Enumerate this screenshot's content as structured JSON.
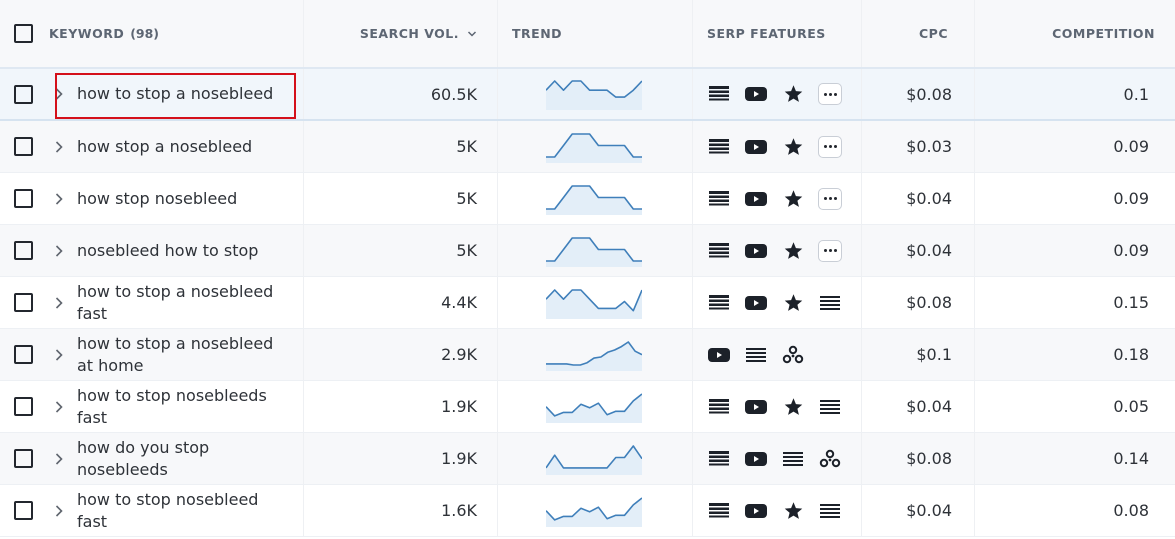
{
  "header": {
    "keyword_label": "KEYWORD",
    "keyword_count": "(98)",
    "search_vol_label": "SEARCH VOL.",
    "trend_label": "TREND",
    "serp_label": "SERP FEATURES",
    "cpc_label": "CPC",
    "competition_label": "COMPETITION"
  },
  "colors": {
    "trend_line": "#3f7fba",
    "trend_fill": "#e3eef8",
    "highlight_border": "#d4101a",
    "icon_color": "#1c2129"
  },
  "rows": [
    {
      "keyword": "how to stop a nosebleed",
      "volume": "60.5K",
      "cpc": "$0.08",
      "competition": "0.1",
      "highlighted": true,
      "trend": [
        0.6,
        1,
        0.6,
        1,
        1,
        0.6,
        0.6,
        0.6,
        0.3,
        0.3,
        0.6,
        1
      ],
      "serp": [
        "featured-snippet-icon",
        "video-icon",
        "review-star-icon",
        "more-icon"
      ]
    },
    {
      "keyword": "how stop a nosebleed",
      "volume": "5K",
      "cpc": "$0.03",
      "competition": "0.09",
      "highlighted": false,
      "trend": [
        0,
        0,
        0.5,
        1,
        1,
        1,
        0.5,
        0.5,
        0.5,
        0.5,
        0,
        0
      ],
      "serp": [
        "featured-snippet-icon",
        "video-icon",
        "review-star-icon",
        "more-icon"
      ]
    },
    {
      "keyword": "how stop nosebleed",
      "volume": "5K",
      "cpc": "$0.04",
      "competition": "0.09",
      "highlighted": false,
      "trend": [
        0,
        0,
        0.5,
        1,
        1,
        1,
        0.5,
        0.5,
        0.5,
        0.5,
        0,
        0
      ],
      "serp": [
        "featured-snippet-icon",
        "video-icon",
        "review-star-icon",
        "more-icon"
      ]
    },
    {
      "keyword": "nosebleed how to stop",
      "volume": "5K",
      "cpc": "$0.04",
      "competition": "0.09",
      "highlighted": false,
      "trend": [
        0,
        0,
        0.5,
        1,
        1,
        1,
        0.5,
        0.5,
        0.5,
        0.5,
        0,
        0
      ],
      "serp": [
        "featured-snippet-icon",
        "video-icon",
        "review-star-icon",
        "more-icon"
      ]
    },
    {
      "keyword": "how to stop a nosebleed fast",
      "volume": "4.4K",
      "cpc": "$0.08",
      "competition": "0.15",
      "highlighted": false,
      "trend": [
        0.6,
        1,
        0.6,
        1,
        1,
        0.6,
        0.2,
        0.2,
        0.2,
        0.5,
        0.1,
        1
      ],
      "serp": [
        "featured-snippet-icon",
        "video-icon",
        "review-star-icon",
        "list-icon"
      ]
    },
    {
      "keyword": "how to stop a nosebleed at home",
      "volume": "2.9K",
      "cpc": "$0.1",
      "competition": "0.18",
      "highlighted": false,
      "trend": [
        0.05,
        0.05,
        0.05,
        0.05,
        0,
        0,
        0.1,
        0.3,
        0.35,
        0.55,
        0.65,
        0.8,
        1,
        0.6,
        0.45
      ],
      "serp": [
        "video-icon",
        "list-icon",
        "people-also-ask-icon"
      ]
    },
    {
      "keyword": "how to stop nosebleeds fast",
      "volume": "1.9K",
      "cpc": "$0.04",
      "competition": "0.05",
      "highlighted": false,
      "trend": [
        0.45,
        0.05,
        0.2,
        0.2,
        0.55,
        0.4,
        0.6,
        0.1,
        0.25,
        0.25,
        0.7,
        1
      ],
      "serp": [
        "featured-snippet-icon",
        "video-icon",
        "review-star-icon",
        "list-icon"
      ]
    },
    {
      "keyword": "how do you stop nosebleeds",
      "volume": "1.9K",
      "cpc": "$0.08",
      "competition": "0.14",
      "highlighted": false,
      "trend": [
        0.05,
        0.6,
        0.05,
        0.05,
        0.05,
        0.05,
        0.05,
        0.05,
        0.5,
        0.5,
        1,
        0.45
      ],
      "serp": [
        "featured-snippet-icon",
        "video-icon",
        "list-icon",
        "people-also-ask-icon"
      ]
    },
    {
      "keyword": "how to stop nosebleed fast",
      "volume": "1.6K",
      "cpc": "$0.04",
      "competition": "0.08",
      "highlighted": false,
      "trend": [
        0.45,
        0.05,
        0.2,
        0.2,
        0.55,
        0.4,
        0.6,
        0.1,
        0.25,
        0.25,
        0.7,
        1
      ],
      "serp": [
        "featured-snippet-icon",
        "video-icon",
        "review-star-icon",
        "list-icon"
      ]
    }
  ]
}
